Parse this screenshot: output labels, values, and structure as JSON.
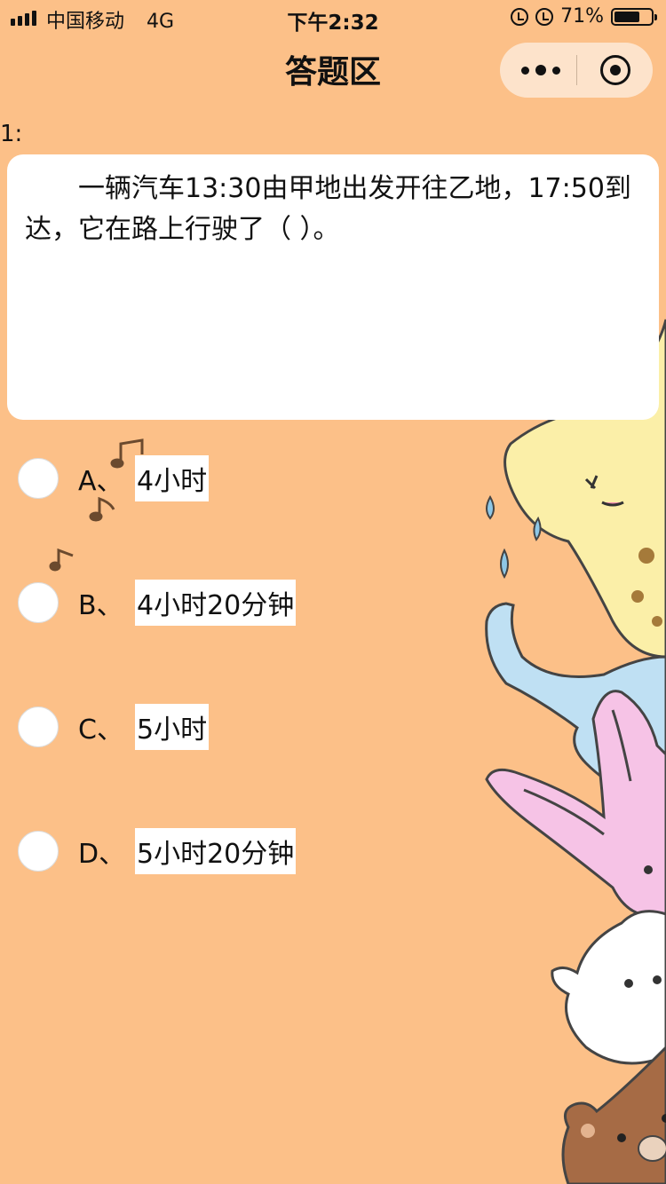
{
  "status_bar": {
    "carrier": "中国移动",
    "network": "4G",
    "time": "下午2:32",
    "battery_percent": "71%",
    "battery_level": 0.71,
    "icons": [
      "signal-icon",
      "orientation-lock-icon",
      "alarm-icon",
      "battery-icon"
    ]
  },
  "nav": {
    "title": "答题区",
    "more_icon": "more-dots-icon",
    "close_icon": "target-circle-icon"
  },
  "question": {
    "number": "1:",
    "text": "一辆汽车13:30由甲地出发开往乙地，17:50到达，它在路上行驶了（ ）。"
  },
  "options": [
    {
      "letter": "A、",
      "text": "4小时"
    },
    {
      "letter": "B、",
      "text": "4小时20分钟"
    },
    {
      "letter": "C、",
      "text": "5小时"
    },
    {
      "letter": "D、",
      "text": "5小时20分钟"
    }
  ],
  "colors": {
    "background": "#FCC088",
    "card": "#FFFFFF",
    "capsule": "#FDE3CB"
  }
}
